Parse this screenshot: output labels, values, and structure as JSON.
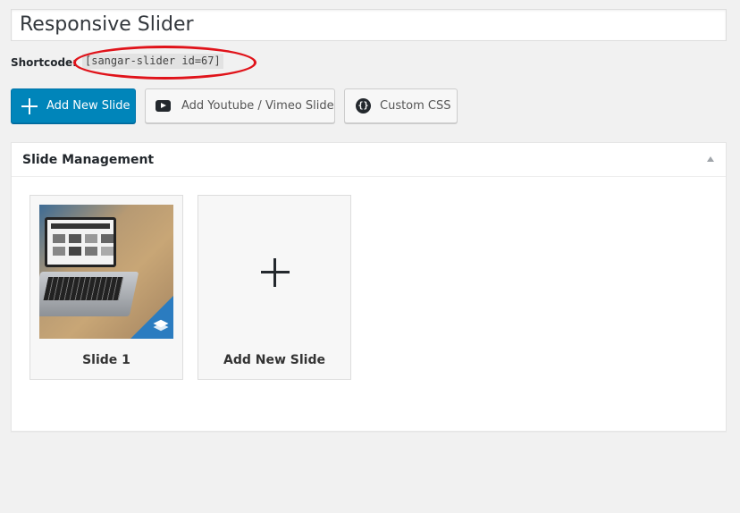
{
  "title_input": {
    "value": "Responsive Slider"
  },
  "shortcode": {
    "label": "Shortcode:",
    "code": "[sangar-slider id=67]"
  },
  "toolbar": {
    "add_slide_label": "Add New Slide",
    "add_video_label": "Add Youtube / Vimeo Slide",
    "custom_css_label": "Custom CSS"
  },
  "panel": {
    "title": "Slide Management",
    "slides": [
      {
        "label": "Slide 1"
      }
    ],
    "add_card_label": "Add New Slide"
  },
  "icons": {
    "add_slide": "plus-icon",
    "add_video": "youtube-play-icon",
    "custom_css": "code-braces-icon",
    "slide_badge": "layers-icon",
    "panel_toggle": "triangle-up-icon",
    "add_card": "plus-icon"
  },
  "colors": {
    "primary": "#0085ba",
    "highlight_oval": "#e0131a",
    "badge": "#2b7cc0",
    "background": "#f1f1f1"
  }
}
